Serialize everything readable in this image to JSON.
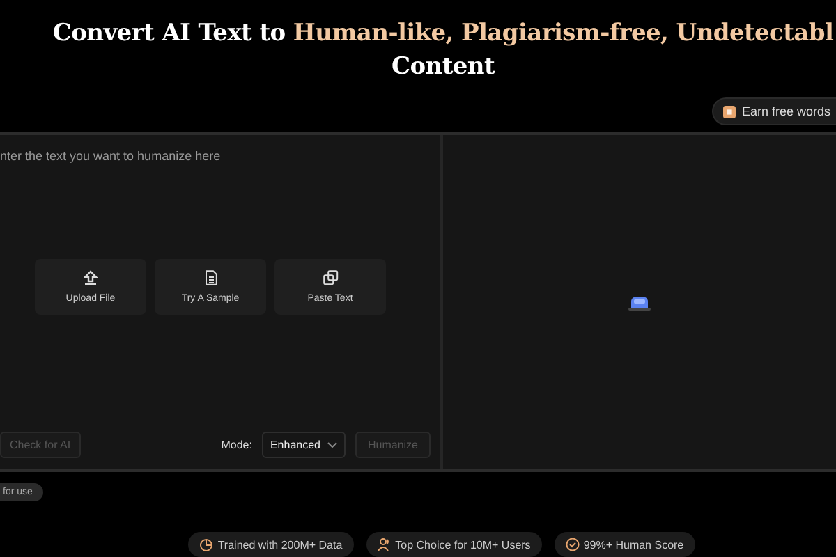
{
  "headline": {
    "lead": "Convert AI Text to ",
    "highlight": "Human-like, Plagiarism-free, Undetectabl",
    "line2": "Content"
  },
  "earn_button": {
    "label": "Earn free words"
  },
  "editor": {
    "placeholder": "nter the text you want to humanize here",
    "actions": [
      {
        "kind": "upload",
        "label": "Upload File"
      },
      {
        "kind": "sample",
        "label": "Try A Sample"
      },
      {
        "kind": "paste",
        "label": "Paste Text"
      }
    ],
    "check_button": {
      "label": "Check for AI",
      "disabled": true
    },
    "mode_label": "Mode:",
    "mode_value": "Enhanced",
    "humanize_button": {
      "label": "Humanize",
      "disabled": true
    }
  },
  "usage_tag": "for use",
  "badges": [
    {
      "kind": "chart",
      "label": "Trained with 200M+ Data"
    },
    {
      "kind": "users",
      "label": "Top Choice for 10M+ Users"
    },
    {
      "kind": "check",
      "label": "99%+ Human Score"
    }
  ]
}
